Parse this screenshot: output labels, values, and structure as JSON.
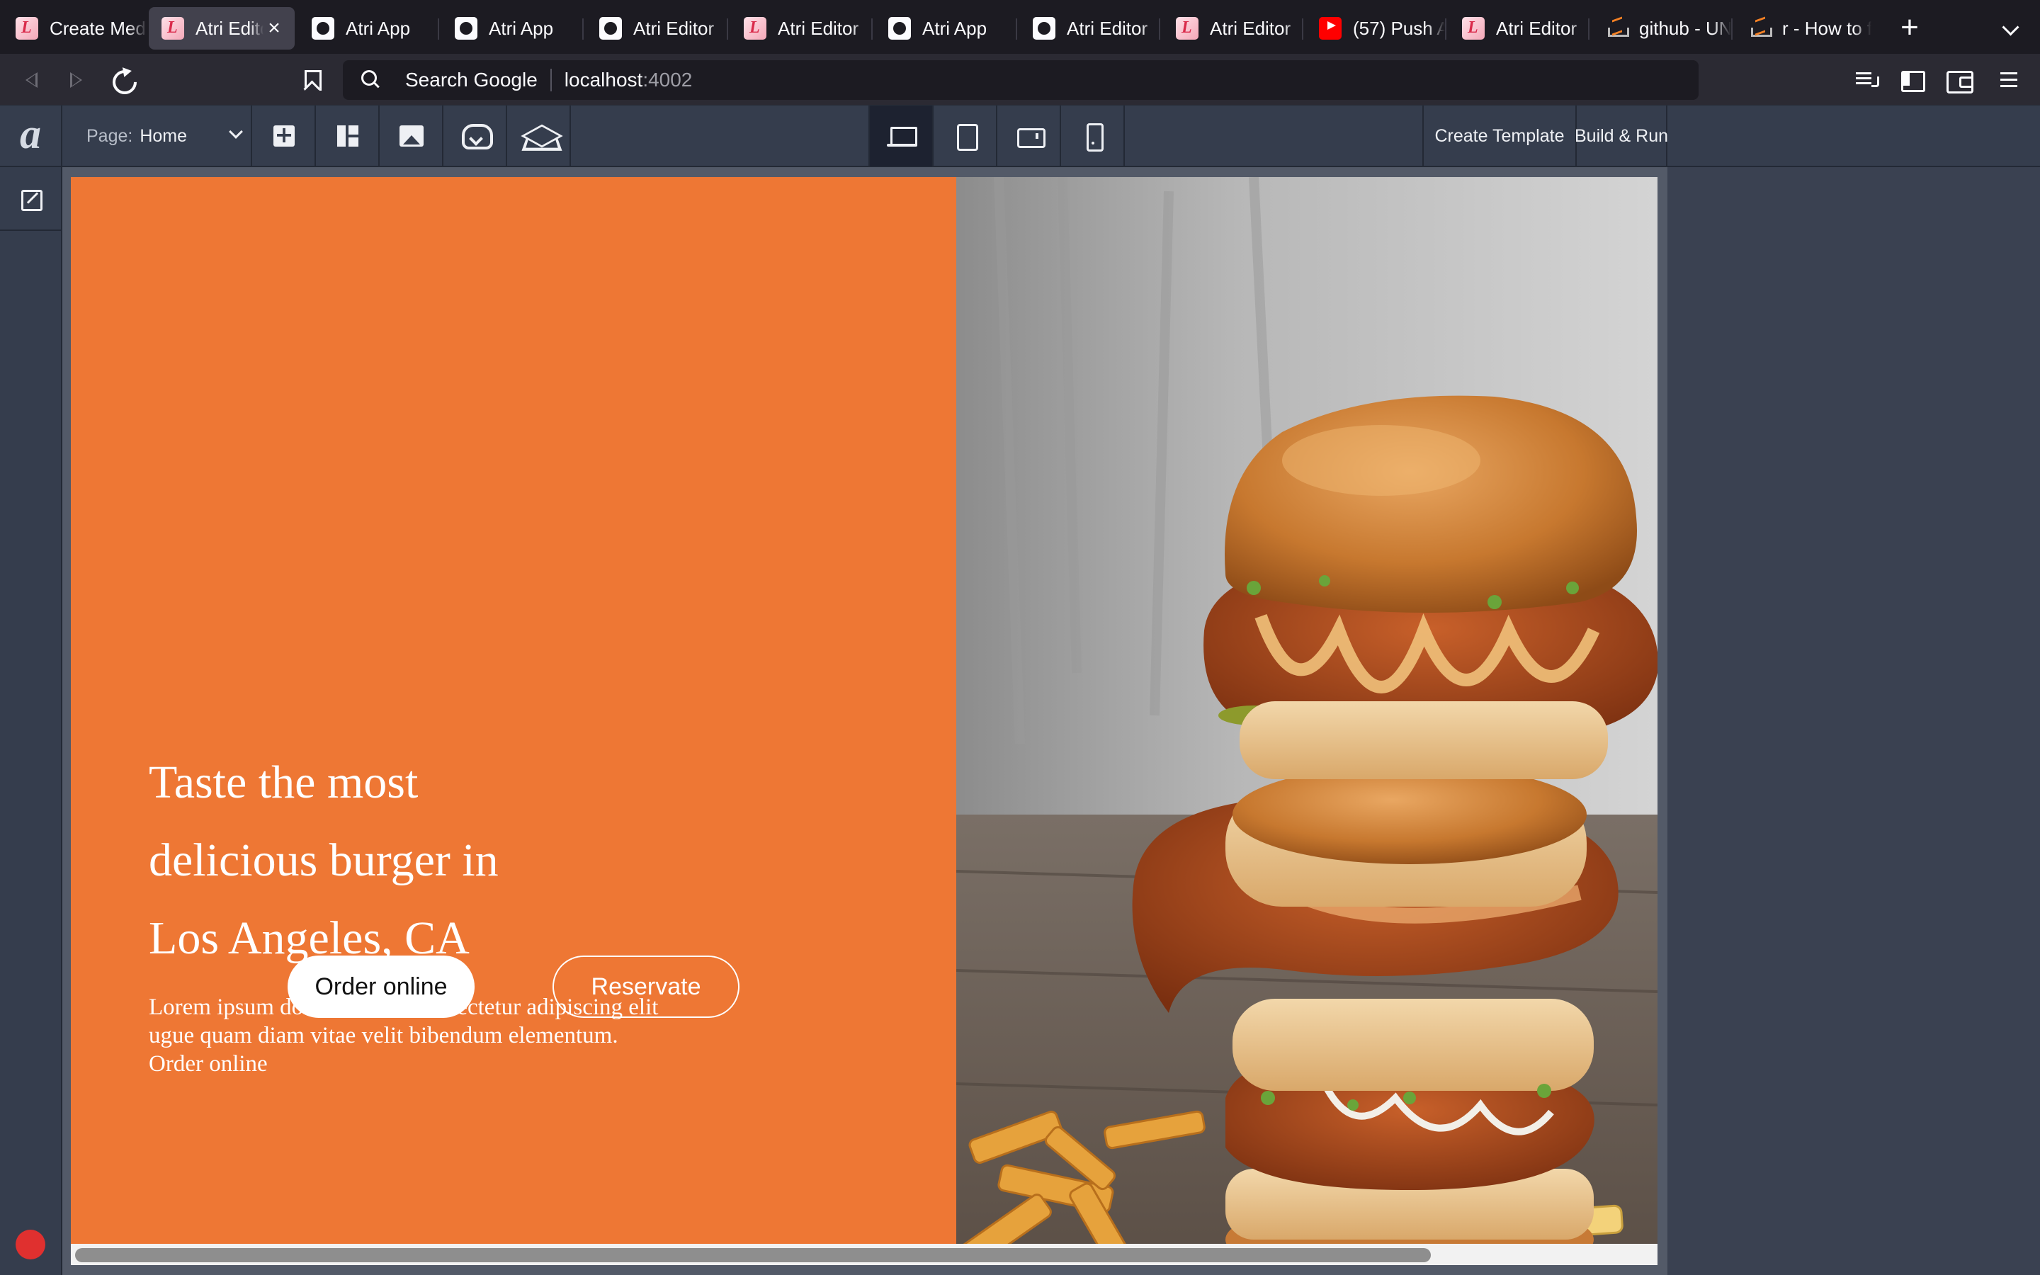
{
  "browser": {
    "tabs": [
      {
        "title": "Create Media",
        "favicon": "atri-icon"
      },
      {
        "title": "Atri Editor",
        "favicon": "atri-icon",
        "active": true
      },
      {
        "title": "Atri App",
        "favicon": "globe-icon"
      },
      {
        "title": "Atri App",
        "favicon": "globe-icon"
      },
      {
        "title": "Atri Editor",
        "favicon": "globe-icon"
      },
      {
        "title": "Atri Editor",
        "favicon": "atri-icon"
      },
      {
        "title": "Atri App",
        "favicon": "globe-icon"
      },
      {
        "title": "Atri Editor",
        "favicon": "globe-icon"
      },
      {
        "title": "Atri Editor",
        "favicon": "atri-icon"
      },
      {
        "title": "(57) Push A",
        "favicon": "youtube-icon"
      },
      {
        "title": "Atri Editor",
        "favicon": "atri-icon"
      },
      {
        "title": "github - UN",
        "favicon": "stackoverflow-icon"
      },
      {
        "title": "r - How to f",
        "favicon": "stackoverflow-icon"
      }
    ],
    "url_bar": {
      "engine_label": "Search Google",
      "host": "localhost",
      "port": ":4002"
    }
  },
  "editor": {
    "logo": "a",
    "page_selector": {
      "label": "Page:",
      "value": "Home"
    },
    "toolbar_icons": [
      "add-component-icon",
      "layout-icon",
      "image-icon",
      "cloud-download-icon",
      "layers-icon"
    ],
    "devices": [
      "desktop-icon",
      "tablet-icon",
      "tablet-landscape-icon",
      "mobile-icon"
    ],
    "actions": {
      "create_template": "Create Template",
      "build_run": "Build & Run"
    }
  },
  "hero": {
    "title_lines": [
      "Taste the most",
      "delicious burger in",
      "Los Angeles, CA"
    ],
    "subtitle_lines": [
      "Lorem ipsum dolor sit amet consectetur adipiscing elit",
      "ugue quam diam vitae velit bibendum elementum.",
      "Order online"
    ],
    "order_button": "Order online",
    "reserve_button": "Reservate",
    "accent_color": "#ee7734"
  }
}
